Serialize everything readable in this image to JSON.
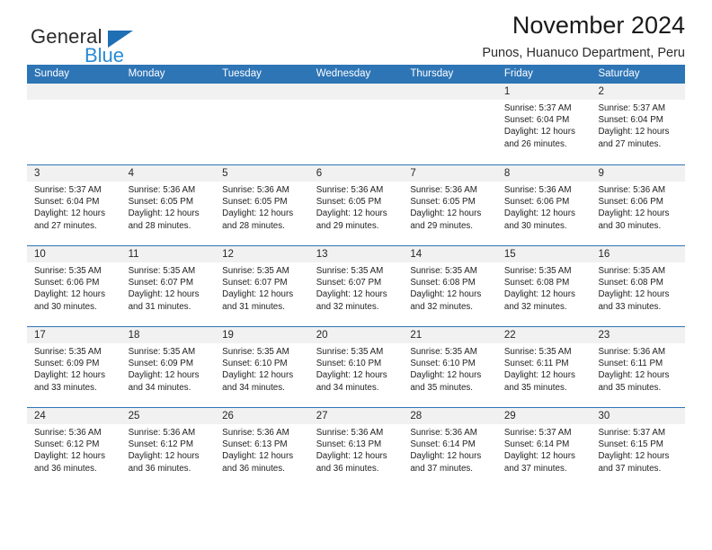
{
  "logo": {
    "primary_text": "General",
    "secondary_text": "Blue",
    "triangle_color": "#1f6fb4",
    "secondary_color": "#2a8bd5"
  },
  "header": {
    "title": "November 2024",
    "location": "Punos, Huanuco Department, Peru"
  },
  "theme": {
    "header_blue": "#2e75b6",
    "day_band_gray": "#f1f1f1",
    "text_dark": "#222222"
  },
  "calendar": {
    "weekdays": [
      "Sunday",
      "Monday",
      "Tuesday",
      "Wednesday",
      "Thursday",
      "Friday",
      "Saturday"
    ],
    "weeks": [
      [
        {
          "day": "",
          "empty": true,
          "sunrise": "",
          "sunset": "",
          "daylight_line1": "",
          "daylight_line2": ""
        },
        {
          "day": "",
          "empty": true,
          "sunrise": "",
          "sunset": "",
          "daylight_line1": "",
          "daylight_line2": ""
        },
        {
          "day": "",
          "empty": true,
          "sunrise": "",
          "sunset": "",
          "daylight_line1": "",
          "daylight_line2": ""
        },
        {
          "day": "",
          "empty": true,
          "sunrise": "",
          "sunset": "",
          "daylight_line1": "",
          "daylight_line2": ""
        },
        {
          "day": "",
          "empty": true,
          "sunrise": "",
          "sunset": "",
          "daylight_line1": "",
          "daylight_line2": ""
        },
        {
          "day": "1",
          "sunrise": "Sunrise: 5:37 AM",
          "sunset": "Sunset: 6:04 PM",
          "daylight_line1": "Daylight: 12 hours",
          "daylight_line2": "and 26 minutes."
        },
        {
          "day": "2",
          "sunrise": "Sunrise: 5:37 AM",
          "sunset": "Sunset: 6:04 PM",
          "daylight_line1": "Daylight: 12 hours",
          "daylight_line2": "and 27 minutes."
        }
      ],
      [
        {
          "day": "3",
          "sunrise": "Sunrise: 5:37 AM",
          "sunset": "Sunset: 6:04 PM",
          "daylight_line1": "Daylight: 12 hours",
          "daylight_line2": "and 27 minutes."
        },
        {
          "day": "4",
          "sunrise": "Sunrise: 5:36 AM",
          "sunset": "Sunset: 6:05 PM",
          "daylight_line1": "Daylight: 12 hours",
          "daylight_line2": "and 28 minutes."
        },
        {
          "day": "5",
          "sunrise": "Sunrise: 5:36 AM",
          "sunset": "Sunset: 6:05 PM",
          "daylight_line1": "Daylight: 12 hours",
          "daylight_line2": "and 28 minutes."
        },
        {
          "day": "6",
          "sunrise": "Sunrise: 5:36 AM",
          "sunset": "Sunset: 6:05 PM",
          "daylight_line1": "Daylight: 12 hours",
          "daylight_line2": "and 29 minutes."
        },
        {
          "day": "7",
          "sunrise": "Sunrise: 5:36 AM",
          "sunset": "Sunset: 6:05 PM",
          "daylight_line1": "Daylight: 12 hours",
          "daylight_line2": "and 29 minutes."
        },
        {
          "day": "8",
          "sunrise": "Sunrise: 5:36 AM",
          "sunset": "Sunset: 6:06 PM",
          "daylight_line1": "Daylight: 12 hours",
          "daylight_line2": "and 30 minutes."
        },
        {
          "day": "9",
          "sunrise": "Sunrise: 5:36 AM",
          "sunset": "Sunset: 6:06 PM",
          "daylight_line1": "Daylight: 12 hours",
          "daylight_line2": "and 30 minutes."
        }
      ],
      [
        {
          "day": "10",
          "sunrise": "Sunrise: 5:35 AM",
          "sunset": "Sunset: 6:06 PM",
          "daylight_line1": "Daylight: 12 hours",
          "daylight_line2": "and 30 minutes."
        },
        {
          "day": "11",
          "sunrise": "Sunrise: 5:35 AM",
          "sunset": "Sunset: 6:07 PM",
          "daylight_line1": "Daylight: 12 hours",
          "daylight_line2": "and 31 minutes."
        },
        {
          "day": "12",
          "sunrise": "Sunrise: 5:35 AM",
          "sunset": "Sunset: 6:07 PM",
          "daylight_line1": "Daylight: 12 hours",
          "daylight_line2": "and 31 minutes."
        },
        {
          "day": "13",
          "sunrise": "Sunrise: 5:35 AM",
          "sunset": "Sunset: 6:07 PM",
          "daylight_line1": "Daylight: 12 hours",
          "daylight_line2": "and 32 minutes."
        },
        {
          "day": "14",
          "sunrise": "Sunrise: 5:35 AM",
          "sunset": "Sunset: 6:08 PM",
          "daylight_line1": "Daylight: 12 hours",
          "daylight_line2": "and 32 minutes."
        },
        {
          "day": "15",
          "sunrise": "Sunrise: 5:35 AM",
          "sunset": "Sunset: 6:08 PM",
          "daylight_line1": "Daylight: 12 hours",
          "daylight_line2": "and 32 minutes."
        },
        {
          "day": "16",
          "sunrise": "Sunrise: 5:35 AM",
          "sunset": "Sunset: 6:08 PM",
          "daylight_line1": "Daylight: 12 hours",
          "daylight_line2": "and 33 minutes."
        }
      ],
      [
        {
          "day": "17",
          "sunrise": "Sunrise: 5:35 AM",
          "sunset": "Sunset: 6:09 PM",
          "daylight_line1": "Daylight: 12 hours",
          "daylight_line2": "and 33 minutes."
        },
        {
          "day": "18",
          "sunrise": "Sunrise: 5:35 AM",
          "sunset": "Sunset: 6:09 PM",
          "daylight_line1": "Daylight: 12 hours",
          "daylight_line2": "and 34 minutes."
        },
        {
          "day": "19",
          "sunrise": "Sunrise: 5:35 AM",
          "sunset": "Sunset: 6:10 PM",
          "daylight_line1": "Daylight: 12 hours",
          "daylight_line2": "and 34 minutes."
        },
        {
          "day": "20",
          "sunrise": "Sunrise: 5:35 AM",
          "sunset": "Sunset: 6:10 PM",
          "daylight_line1": "Daylight: 12 hours",
          "daylight_line2": "and 34 minutes."
        },
        {
          "day": "21",
          "sunrise": "Sunrise: 5:35 AM",
          "sunset": "Sunset: 6:10 PM",
          "daylight_line1": "Daylight: 12 hours",
          "daylight_line2": "and 35 minutes."
        },
        {
          "day": "22",
          "sunrise": "Sunrise: 5:35 AM",
          "sunset": "Sunset: 6:11 PM",
          "daylight_line1": "Daylight: 12 hours",
          "daylight_line2": "and 35 minutes."
        },
        {
          "day": "23",
          "sunrise": "Sunrise: 5:36 AM",
          "sunset": "Sunset: 6:11 PM",
          "daylight_line1": "Daylight: 12 hours",
          "daylight_line2": "and 35 minutes."
        }
      ],
      [
        {
          "day": "24",
          "sunrise": "Sunrise: 5:36 AM",
          "sunset": "Sunset: 6:12 PM",
          "daylight_line1": "Daylight: 12 hours",
          "daylight_line2": "and 36 minutes."
        },
        {
          "day": "25",
          "sunrise": "Sunrise: 5:36 AM",
          "sunset": "Sunset: 6:12 PM",
          "daylight_line1": "Daylight: 12 hours",
          "daylight_line2": "and 36 minutes."
        },
        {
          "day": "26",
          "sunrise": "Sunrise: 5:36 AM",
          "sunset": "Sunset: 6:13 PM",
          "daylight_line1": "Daylight: 12 hours",
          "daylight_line2": "and 36 minutes."
        },
        {
          "day": "27",
          "sunrise": "Sunrise: 5:36 AM",
          "sunset": "Sunset: 6:13 PM",
          "daylight_line1": "Daylight: 12 hours",
          "daylight_line2": "and 36 minutes."
        },
        {
          "day": "28",
          "sunrise": "Sunrise: 5:36 AM",
          "sunset": "Sunset: 6:14 PM",
          "daylight_line1": "Daylight: 12 hours",
          "daylight_line2": "and 37 minutes."
        },
        {
          "day": "29",
          "sunrise": "Sunrise: 5:37 AM",
          "sunset": "Sunset: 6:14 PM",
          "daylight_line1": "Daylight: 12 hours",
          "daylight_line2": "and 37 minutes."
        },
        {
          "day": "30",
          "sunrise": "Sunrise: 5:37 AM",
          "sunset": "Sunset: 6:15 PM",
          "daylight_line1": "Daylight: 12 hours",
          "daylight_line2": "and 37 minutes."
        }
      ]
    ]
  }
}
